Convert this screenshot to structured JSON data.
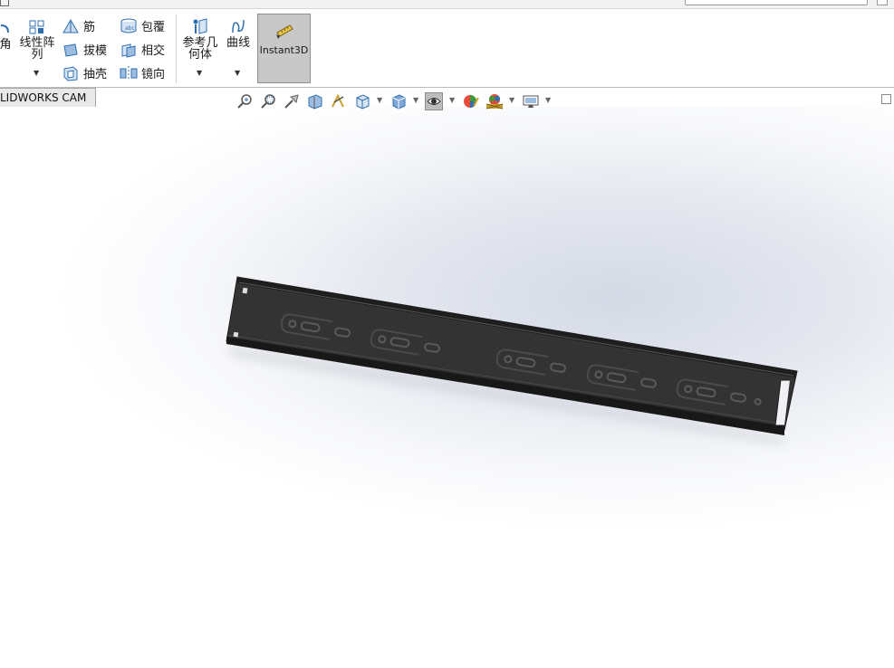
{
  "ribbon": {
    "fillet_partial": "角",
    "linear_pattern": "线性阵列",
    "rib": "筋",
    "draft": "拔模",
    "shell": "抽壳",
    "wrap": "包覆",
    "intersect": "相交",
    "mirror": "镜向",
    "reference_geometry": "参考几何体",
    "curves": "曲线",
    "instant3d": "Instant3D"
  },
  "tabs": {
    "cam": "LIDWORKS CAM"
  },
  "heads_up_toolbar": {
    "icons": [
      "zoom-to-fit-icon",
      "zoom-to-area-icon",
      "previous-view-icon",
      "section-view-icon",
      "dynamic-annotation-icon",
      "view-orientation-icon",
      "display-style-icon",
      "hide-show-items-icon",
      "edit-appearance-icon",
      "apply-scene-icon",
      "view-settings-icon"
    ]
  },
  "colors": {
    "part": "#2b2b2b",
    "viewport_tint": "#d4d9e5",
    "instant3d_active": "#c8c8c8"
  }
}
